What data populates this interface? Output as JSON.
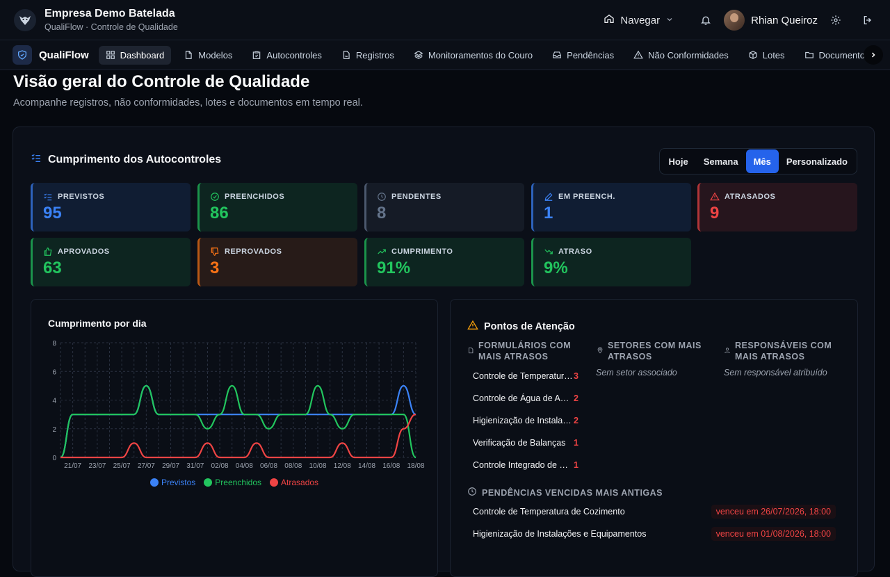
{
  "header": {
    "company": "Empresa Demo Batelada",
    "subtitle": "QualiFlow · Controle de Qualidade",
    "navigate": "Navegar",
    "user": "Rhian Queiroz"
  },
  "nav": {
    "brand": "QualiFlow",
    "items": [
      {
        "label": "Dashboard",
        "icon": "dashboard-icon",
        "active": true
      },
      {
        "label": "Modelos",
        "icon": "file-icon"
      },
      {
        "label": "Autocontroles",
        "icon": "clipboard-check-icon"
      },
      {
        "label": "Registros",
        "icon": "file-signature-icon"
      },
      {
        "label": "Monitoramentos do Couro",
        "icon": "layers-icon"
      },
      {
        "label": "Pendências",
        "icon": "inbox-icon"
      },
      {
        "label": "Não Conformidades",
        "icon": "warning-icon"
      },
      {
        "label": "Lotes",
        "icon": "box-icon"
      },
      {
        "label": "Documentos",
        "icon": "folder-icon"
      }
    ]
  },
  "page": {
    "title": "Visão geral do Controle de Qualidade",
    "subtitle": "Acompanhe registros, não conformidades, lotes e documentos em tempo real."
  },
  "compliance": {
    "title": "Cumprimento dos Autocontroles",
    "periods": [
      "Hoje",
      "Semana",
      "Mês",
      "Personalizado"
    ],
    "active_period": "Mês",
    "cards": [
      {
        "label": "PREVISTOS",
        "value": "95",
        "color": "#3b82f6",
        "icon": "list-check-icon"
      },
      {
        "label": "PREENCHIDOS",
        "value": "86",
        "color": "#22c55e",
        "icon": "check-circle-icon"
      },
      {
        "label": "PENDENTES",
        "value": "8",
        "color": "#64748b",
        "icon": "clock-icon"
      },
      {
        "label": "EM PREENCH.",
        "value": "1",
        "color": "#3b82f6",
        "icon": "pencil-icon"
      },
      {
        "label": "ATRASADOS",
        "value": "9",
        "color": "#ef4444",
        "icon": "warning-icon"
      },
      {
        "label": "APROVADOS",
        "value": "63",
        "color": "#22c55e",
        "icon": "thumbs-up-icon"
      },
      {
        "label": "REPROVADOS",
        "value": "3",
        "color": "#f97316",
        "icon": "thumbs-down-icon"
      },
      {
        "label": "CUMPRIMENTO",
        "value": "91%",
        "color": "#22c55e",
        "icon": "trending-up-icon"
      },
      {
        "label": "ATRASO",
        "value": "9%",
        "color": "#22c55e",
        "icon": "trending-down-icon"
      }
    ]
  },
  "attention": {
    "title": "Pontos de Atenção",
    "forms_title": "FORMULÁRIOS COM MAIS ATRASOS",
    "sectors_title": "SETORES COM MAIS ATRASOS",
    "responsible_title": "RESPONSÁVEIS COM MAIS ATRASOS",
    "sectors_empty": "Sem setor associado",
    "responsible_empty": "Sem responsável atribuído",
    "forms": [
      {
        "name": "Controle de Temperatura de Cozimento",
        "count": "3"
      },
      {
        "name": "Controle de Água de Abastecimento",
        "count": "2"
      },
      {
        "name": "Higienização de Instalações e Equipamentos",
        "count": "2"
      },
      {
        "name": "Verificação de Balanças",
        "count": "1"
      },
      {
        "name": "Controle Integrado de Pragas",
        "count": "1"
      }
    ],
    "pending_title": "PENDÊNCIAS VENCIDAS MAIS ANTIGAS",
    "pending": [
      {
        "name": "Controle de Temperatura de Cozimento",
        "due": "venceu em 26/07/2026, 18:00"
      },
      {
        "name": "Higienização de Instalações e Equipamentos",
        "due": "venceu em 01/08/2026, 18:00"
      }
    ]
  },
  "chart_data": {
    "type": "line",
    "title": "Cumprimento por dia",
    "x": [
      "20/07",
      "21/07",
      "22/07",
      "23/07",
      "24/07",
      "25/07",
      "26/07",
      "27/07",
      "28/07",
      "29/07",
      "30/07",
      "31/07",
      "01/08",
      "02/08",
      "03/08",
      "04/08",
      "05/08",
      "06/08",
      "07/08",
      "08/08",
      "09/08",
      "10/08",
      "11/08",
      "12/08",
      "13/08",
      "14/08",
      "15/08",
      "16/08",
      "17/08",
      "18/08"
    ],
    "tick_labels": [
      "21/07",
      "23/07",
      "25/07",
      "27/07",
      "29/07",
      "31/07",
      "02/08",
      "04/08",
      "06/08",
      "08/08",
      "10/08",
      "12/08",
      "14/08",
      "16/08",
      "18/08"
    ],
    "ylim": [
      0,
      8
    ],
    "yticks": [
      0,
      2,
      4,
      6,
      8
    ],
    "grid": true,
    "legend_position": "bottom",
    "series": [
      {
        "name": "Previstos",
        "color": "#3b82f6",
        "values": [
          0,
          3,
          3,
          3,
          3,
          3,
          3,
          5,
          3,
          3,
          3,
          3,
          3,
          3,
          3,
          3,
          3,
          3,
          3,
          3,
          3,
          3,
          3,
          3,
          3,
          3,
          3,
          3,
          5,
          3
        ]
      },
      {
        "name": "Preenchidos",
        "color": "#22c55e",
        "values": [
          0,
          3,
          3,
          3,
          3,
          3,
          3,
          5,
          3,
          3,
          3,
          3,
          2,
          3,
          5,
          3,
          3,
          2,
          3,
          3,
          3,
          5,
          3,
          2,
          3,
          3,
          3,
          3,
          3,
          0
        ]
      },
      {
        "name": "Atrasados",
        "color": "#ef4444",
        "values": [
          0,
          0,
          0,
          0,
          0,
          0,
          1,
          0,
          0,
          0,
          0,
          0,
          1,
          0,
          0,
          0,
          1,
          0,
          0,
          0,
          0,
          0,
          0,
          1,
          0,
          0,
          0,
          0,
          2,
          3
        ]
      }
    ]
  }
}
